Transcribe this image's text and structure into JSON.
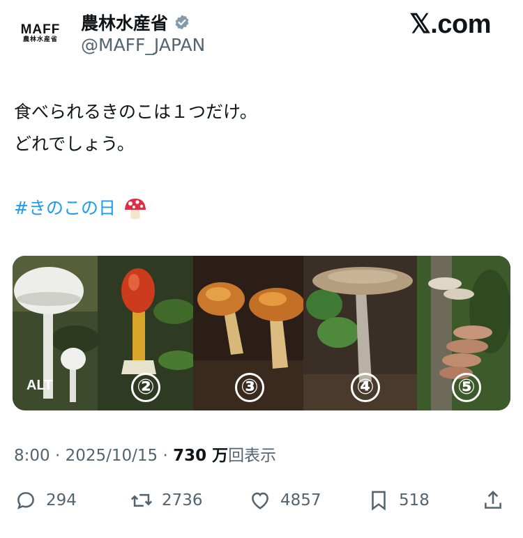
{
  "header": {
    "logo_text": "MAFF",
    "logo_subtext": "農林水産省",
    "account_name": "農林水産省",
    "handle": "@MAFF_JAPAN",
    "site_label": "𝕏.com"
  },
  "post": {
    "line1": "食べられるきのこは１つだけ。",
    "line2": "どれでしょう。",
    "hashtag": "#きのこの日",
    "emoji": "mushroom-emoji"
  },
  "media": {
    "alt_badge": "ALT",
    "panels": [
      {
        "number": "",
        "description_icon": "white-mushroom"
      },
      {
        "number": "②",
        "description_icon": "red-cap-mushroom"
      },
      {
        "number": "③",
        "description_icon": "orange-mushrooms"
      },
      {
        "number": "④",
        "description_icon": "tan-flat-mushroom"
      },
      {
        "number": "⑤",
        "description_icon": "bracket-fungus"
      }
    ]
  },
  "meta": {
    "time": "8:00",
    "separator": "·",
    "date": "2025/10/15",
    "views_number": "730",
    "views_unit": "万",
    "views_label": "回表示"
  },
  "actions": {
    "replies": "294",
    "reposts": "2736",
    "likes": "4857",
    "bookmarks": "518"
  },
  "colors": {
    "link": "#1d9bf0",
    "secondary_text": "#536471",
    "verified": "#829aab"
  }
}
